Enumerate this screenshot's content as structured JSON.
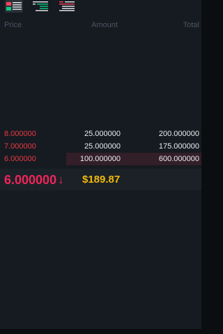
{
  "toolbar": {
    "views": [
      {
        "name": "both",
        "active": true
      },
      {
        "name": "buy-only",
        "active": false
      },
      {
        "name": "sell-only",
        "active": false
      }
    ]
  },
  "headers": {
    "price": "Price",
    "amount": "Amount",
    "total": "Total"
  },
  "asks": [
    {
      "price": "8.000000",
      "amount": "25.000000",
      "total": "200.000000",
      "depth": 0
    },
    {
      "price": "7.000000",
      "amount": "25.000000",
      "total": "175.000000",
      "depth": 0
    },
    {
      "price": "6.000000",
      "amount": "100.000000",
      "total": "600.000000",
      "depth": 0.67
    }
  ],
  "ticker": {
    "last_price": "6.000000",
    "arrow": "↓",
    "fiat_price": "$189.87"
  },
  "colors": {
    "sell": "#ea3943",
    "last_price": "#f0255c",
    "fiat": "#f0b90b",
    "buy": "#0ecb81",
    "background": "#161a21"
  }
}
